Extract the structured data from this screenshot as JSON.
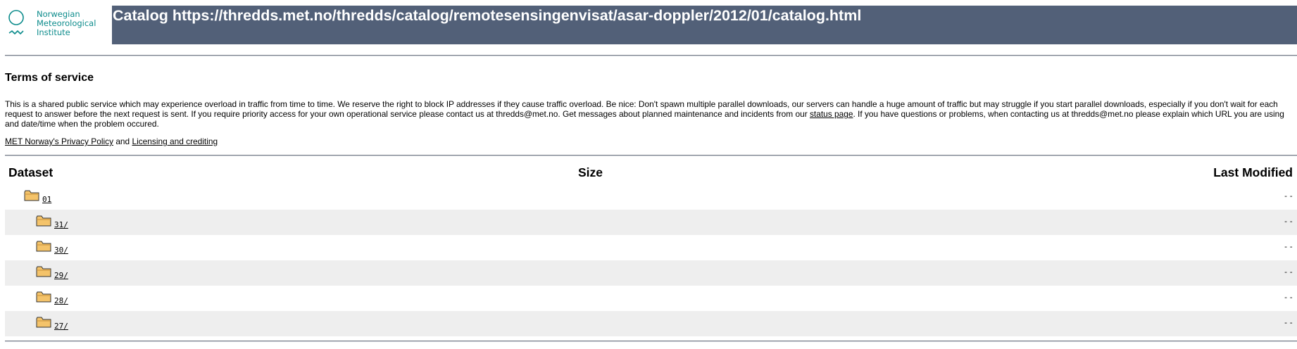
{
  "logo": {
    "line1": "Norwegian",
    "line2": "Meteorological",
    "line3": "Institute",
    "color": "#0d8c8c"
  },
  "header": {
    "title": "Catalog https://thredds.met.no/thredds/catalog/remotesensingenvisat/asar-doppler/2012/01/catalog.html",
    "bar_color": "#526078"
  },
  "terms": {
    "title": "Terms of service",
    "body_part1": "This is a shared public service which may experience overload in traffic from time to time. We reserve the right to block IP addresses if they cause traffic overload. Be nice: Don't spawn multiple parallel downloads, our servers can handle a huge amount of traffic but may struggle if you start parallel downloads, especially if you don't wait for each request to answer before the next request is sent. If you require priority access for your own operational service please contact us at thredds@met.no. Get messages about planned maintenance and incidents from our ",
    "status_link": "status page",
    "body_part2": ". If you have questions or problems, when contacting us at thredds@met.no please explain which URL you are using and date/time when the problem occured.",
    "privacy_link": "MET Norway's Privacy Policy",
    "and": " and ",
    "licensing_link": "Licensing and crediting"
  },
  "table": {
    "headers": {
      "dataset": "Dataset",
      "size": "Size",
      "modified": "Last Modified"
    },
    "rows": [
      {
        "name": "01",
        "modified": "--",
        "level": 0
      },
      {
        "name": "31/",
        "modified": "--",
        "level": 1
      },
      {
        "name": "30/",
        "modified": "--",
        "level": 1
      },
      {
        "name": "29/",
        "modified": "--",
        "level": 1
      },
      {
        "name": "28/",
        "modified": "--",
        "level": 1
      },
      {
        "name": "27/",
        "modified": "--",
        "level": 1
      }
    ]
  }
}
